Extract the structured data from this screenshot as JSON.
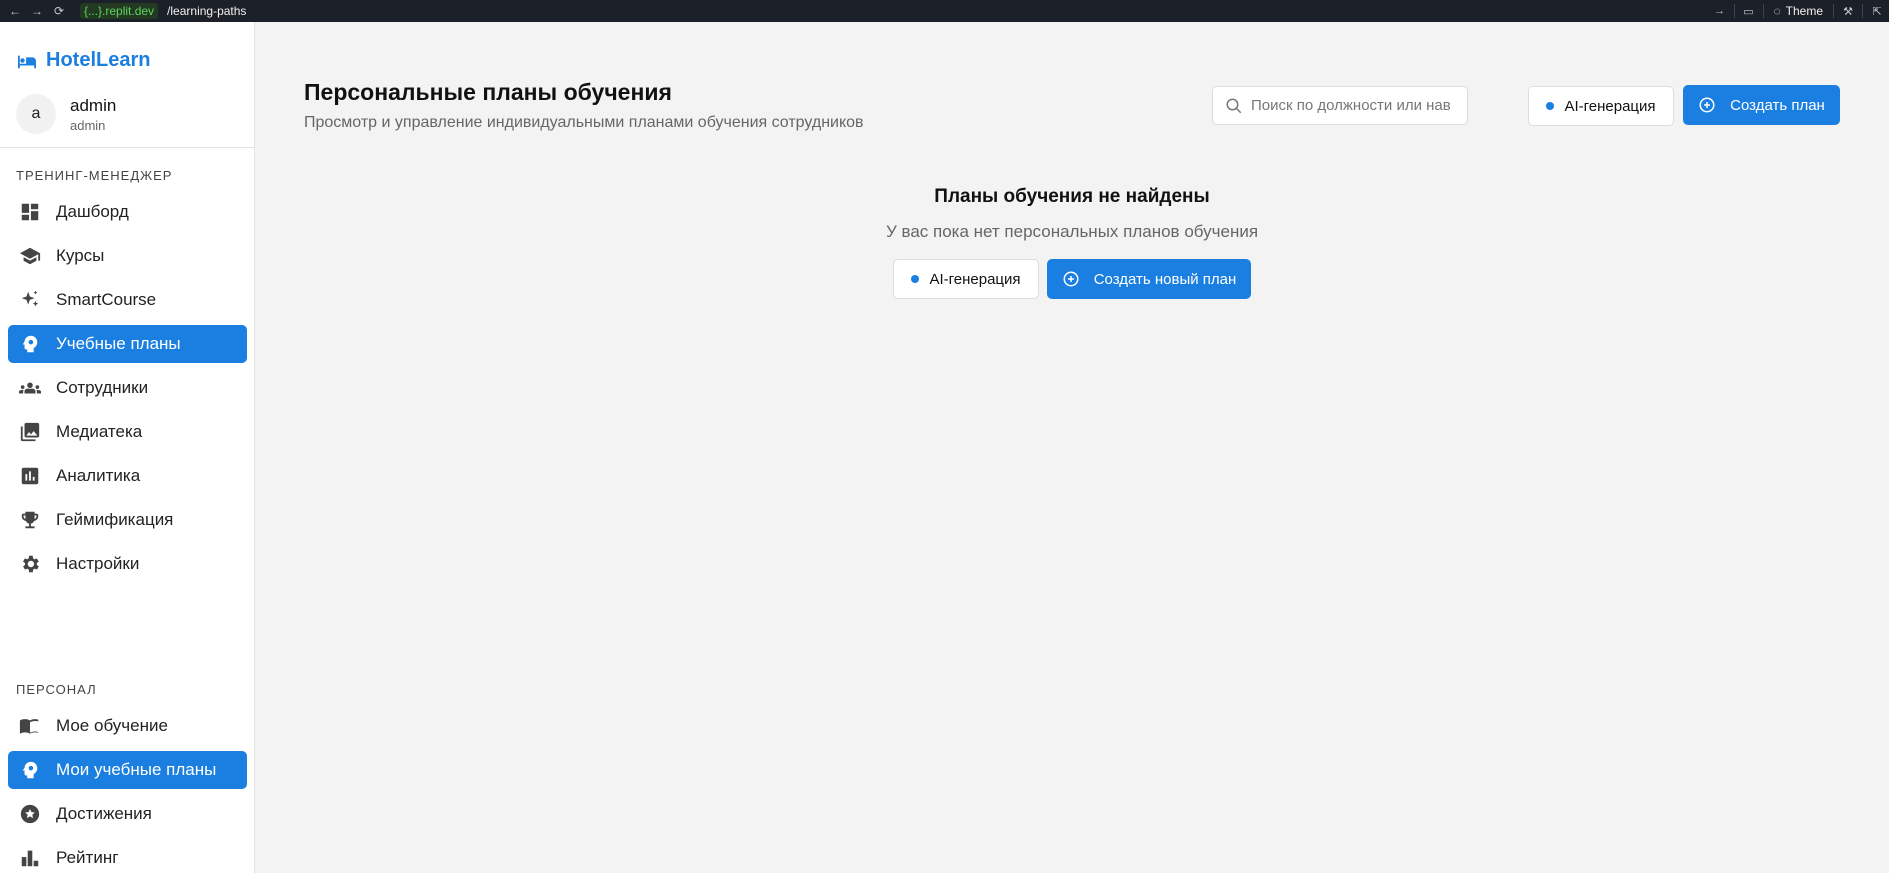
{
  "browser": {
    "url_host": "{...}.replit.dev",
    "url_path": "/learning-paths",
    "theme_label": "Theme"
  },
  "app": {
    "name": "HotelLearn",
    "user": {
      "initial": "a",
      "name": "admin",
      "role": "admin"
    }
  },
  "sidebar": {
    "section_trainer": "ТРЕНИНГ-МЕНЕДЖЕР",
    "trainer_items": [
      {
        "label": "Дашборд",
        "icon": "dashboard-icon"
      },
      {
        "label": "Курсы",
        "icon": "graduation-cap-icon"
      },
      {
        "label": "SmartCourse",
        "icon": "sparkles-icon"
      },
      {
        "label": "Учебные планы",
        "icon": "psychology-head-icon",
        "active": true
      },
      {
        "label": "Сотрудники",
        "icon": "people-icon"
      },
      {
        "label": "Медиатека",
        "icon": "photo-library-icon"
      },
      {
        "label": "Аналитика",
        "icon": "analytics-chart-icon"
      },
      {
        "label": "Геймификация",
        "icon": "trophy-icon"
      },
      {
        "label": "Настройки",
        "icon": "gear-icon"
      }
    ],
    "section_personal": "ПЕРСОНАЛ",
    "personal_items": [
      {
        "label": "Мое обучение",
        "icon": "book-icon"
      },
      {
        "label": "Мои учебные планы",
        "icon": "psychology-head-icon",
        "active": true
      },
      {
        "label": "Достижения",
        "icon": "star-badge-icon"
      },
      {
        "label": "Рейтинг",
        "icon": "leaderboard-icon"
      }
    ]
  },
  "main": {
    "title": "Персональные планы обучения",
    "subtitle": "Просмотр и управление индивидуальными планами обучения сотрудников",
    "search_placeholder": "Поиск по должности или навыкам",
    "ai_button": "AI-генерация",
    "create_button": "Создать план",
    "empty": {
      "title": "Планы обучения не найдены",
      "text": "У вас пока нет персональных планов обучения",
      "ai_button": "AI-генерация",
      "create_button": "Создать новый план"
    }
  },
  "colors": {
    "accent": "#1a7fe0",
    "background": "#f3f3f3",
    "browser_bar": "#1c2029"
  }
}
